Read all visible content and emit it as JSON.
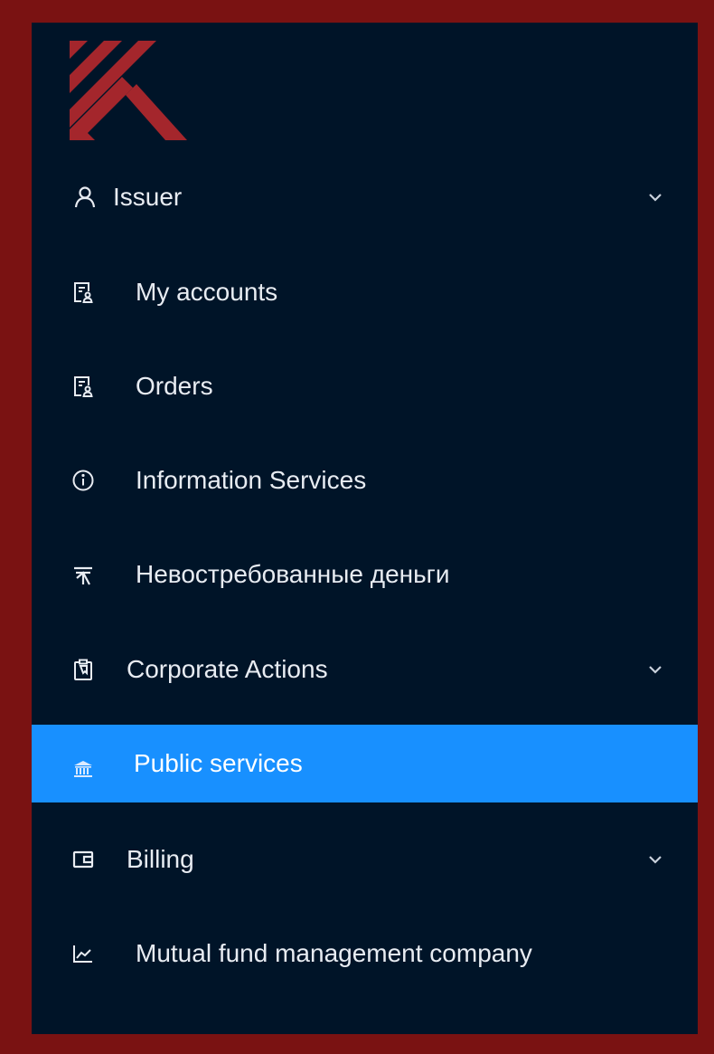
{
  "menu": {
    "items": [
      {
        "label": "Issuer",
        "icon": "user-icon",
        "expandable": true
      },
      {
        "label": "My accounts",
        "icon": "document-user-icon"
      },
      {
        "label": "Orders",
        "icon": "document-user-icon"
      },
      {
        "label": "Information Services",
        "icon": "info-circle-icon"
      },
      {
        "label": "Невостребованные деньги",
        "icon": "money-collect-icon"
      },
      {
        "label": "Corporate Actions",
        "icon": "clipboard-icon",
        "expandable": true
      },
      {
        "label": "Public services",
        "icon": "bank-icon",
        "active": true
      },
      {
        "label": "Billing",
        "icon": "wallet-icon",
        "expandable": true
      },
      {
        "label": "Mutual fund management company",
        "icon": "line-chart-icon"
      }
    ]
  },
  "colors": {
    "frame": "#7a1212",
    "sidebar_bg": "#001428",
    "active_bg": "#1890ff",
    "logo": "#a4262c"
  }
}
